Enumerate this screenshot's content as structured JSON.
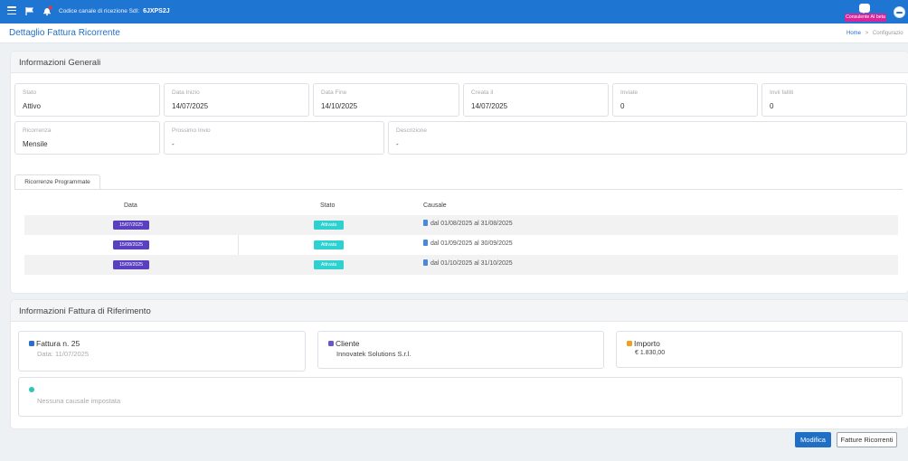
{
  "topbar": {
    "code_label": "Codice canale di ricezione SdI:",
    "code_value": "6JXPS2J",
    "consulente_label": "Consulente AI beta",
    "menu_icon": "hamburger-icon",
    "flag_icon": "flag-icon",
    "bell_icon": "bell-icon",
    "chat_icon": "chat-bubble-icon",
    "avatar_icon": "user-avatar-icon"
  },
  "page": {
    "title": "Dettaglio Fattura Ricorrente",
    "breadcrumb_home": "Home",
    "breadcrumb_sep": ">",
    "breadcrumb_current": "Configurazio"
  },
  "info_generali": {
    "title": "Informazioni Generali",
    "fields": [
      {
        "label": "Stato",
        "value": "Attivo"
      },
      {
        "label": "Data Inizio",
        "value": "14/07/2025"
      },
      {
        "label": "Data Fine",
        "value": "14/10/2025"
      },
      {
        "label": "Creata il",
        "value": "14/07/2025"
      },
      {
        "label": "Inviate",
        "value": "0"
      },
      {
        "label": "Invii falliti",
        "value": "0"
      },
      {
        "label": "Ricorrenza",
        "value": "Mensile"
      },
      {
        "label": "Prossimo Invio",
        "value": "-"
      },
      {
        "label": "Descrizione",
        "value": "-"
      }
    ]
  },
  "ricorrenze": {
    "tab_label": "Ricorrenze Programmate",
    "headers": {
      "data": "Data",
      "stato": "Stato",
      "causale": "Causale"
    },
    "rows": [
      {
        "data": "15/07/2025",
        "stato": "Attivata",
        "causale": "dal 01/08/2025 al 31/08/2025"
      },
      {
        "data": "15/08/2025",
        "stato": "Attivata",
        "causale": "dal 01/09/2025 al 30/09/2025"
      },
      {
        "data": "15/09/2025",
        "stato": "Attivata",
        "causale": "dal 01/10/2025 al 31/10/2025"
      }
    ],
    "colors": {
      "date_badge": "#5a3fc0",
      "stato_badge": "#2ed0d0"
    }
  },
  "fattura_rif": {
    "title": "Informazioni Fattura di Riferimento",
    "fattura_label": "Fattura n. 25",
    "fattura_data": "Data: 11/07/2025",
    "cliente_label": "Cliente",
    "cliente_value": "Innovatek Solutions S.r.l.",
    "importo_label": "Importo",
    "importo_value": "€ 1.830,00",
    "causale_empty": "Nessuna causale impostata"
  },
  "actions": {
    "modifica": "Modifica",
    "fatture_ricorrenti": "Fatture Ricorrenti"
  },
  "colors": {
    "topbar": "#1f76d2",
    "accent": "#1f6fc5",
    "consulente_tag": "#d8259a"
  }
}
